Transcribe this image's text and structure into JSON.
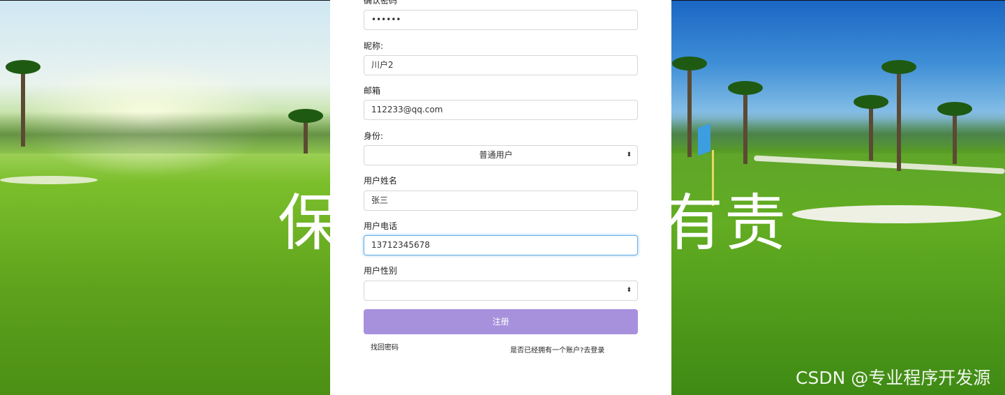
{
  "background": {
    "banner_left": "保",
    "banner_right": "有责"
  },
  "form": {
    "confirm_password": {
      "label": "确认密码",
      "value": "••••••"
    },
    "nickname": {
      "label": "昵称:",
      "value": "川户2"
    },
    "email": {
      "label": "邮箱",
      "value": "112233@qq.com"
    },
    "role": {
      "label": "身份:",
      "value": "普通用户",
      "icon": "select-caret-icon"
    },
    "real_name": {
      "label": "用户姓名",
      "value": "张三"
    },
    "phone": {
      "label": "用户电话",
      "value": "13712345678"
    },
    "gender": {
      "label": "用户性别",
      "value": "",
      "icon": "select-caret-icon"
    },
    "register_button": "注册",
    "forgot_password_link": "找回密码",
    "login_link": "是否已经拥有一个账户?去登录"
  },
  "watermark": "CSDN @专业程序开发源",
  "colors": {
    "register_button": "#a791dc",
    "focus_border": "#66afe9",
    "panel": "#ffffff"
  }
}
